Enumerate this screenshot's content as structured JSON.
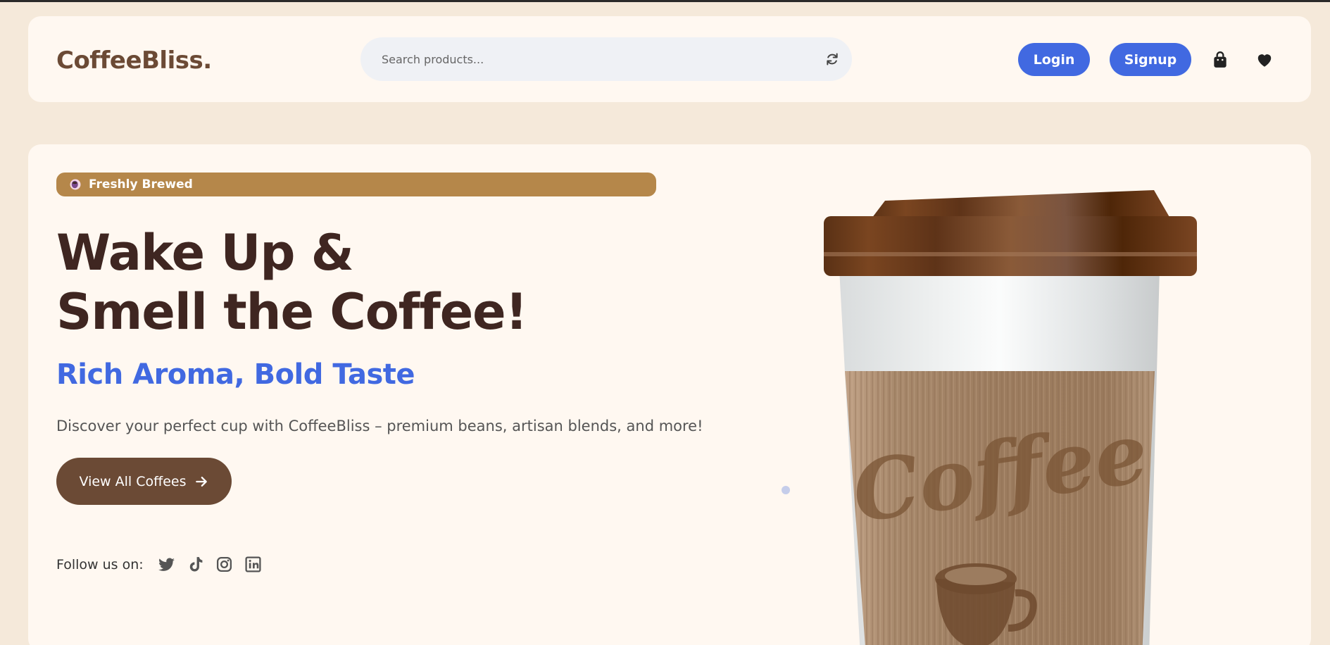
{
  "app": {
    "logo": "CoffeeBliss."
  },
  "header": {
    "search_placeholder": "Search products...",
    "login_label": "Login",
    "signup_label": "Signup",
    "icons": [
      "refresh-icon",
      "shopping-bag-icon",
      "heart-icon"
    ]
  },
  "hero": {
    "badge_label": "Freshly Brewed",
    "title_line1": "Wake Up &",
    "title_line2": "Smell the Coffee!",
    "subtitle": "Rich Aroma, Bold Taste",
    "description": "Discover your perfect cup with CoffeeBliss – premium beans, artisan blends, and more!",
    "cta_label": "View All Coffees",
    "follow_label": "Follow us on:",
    "socials": [
      "twitter-icon",
      "tiktok-icon",
      "instagram-icon",
      "linkedin-icon"
    ],
    "cup_text": "Coffee"
  },
  "colors": {
    "background": "#f5e9da",
    "card": "#fff8f1",
    "accent_blue": "#4169e1",
    "brown": "#6b4a35",
    "badge": "#b5874a",
    "heading": "#3f2621"
  }
}
